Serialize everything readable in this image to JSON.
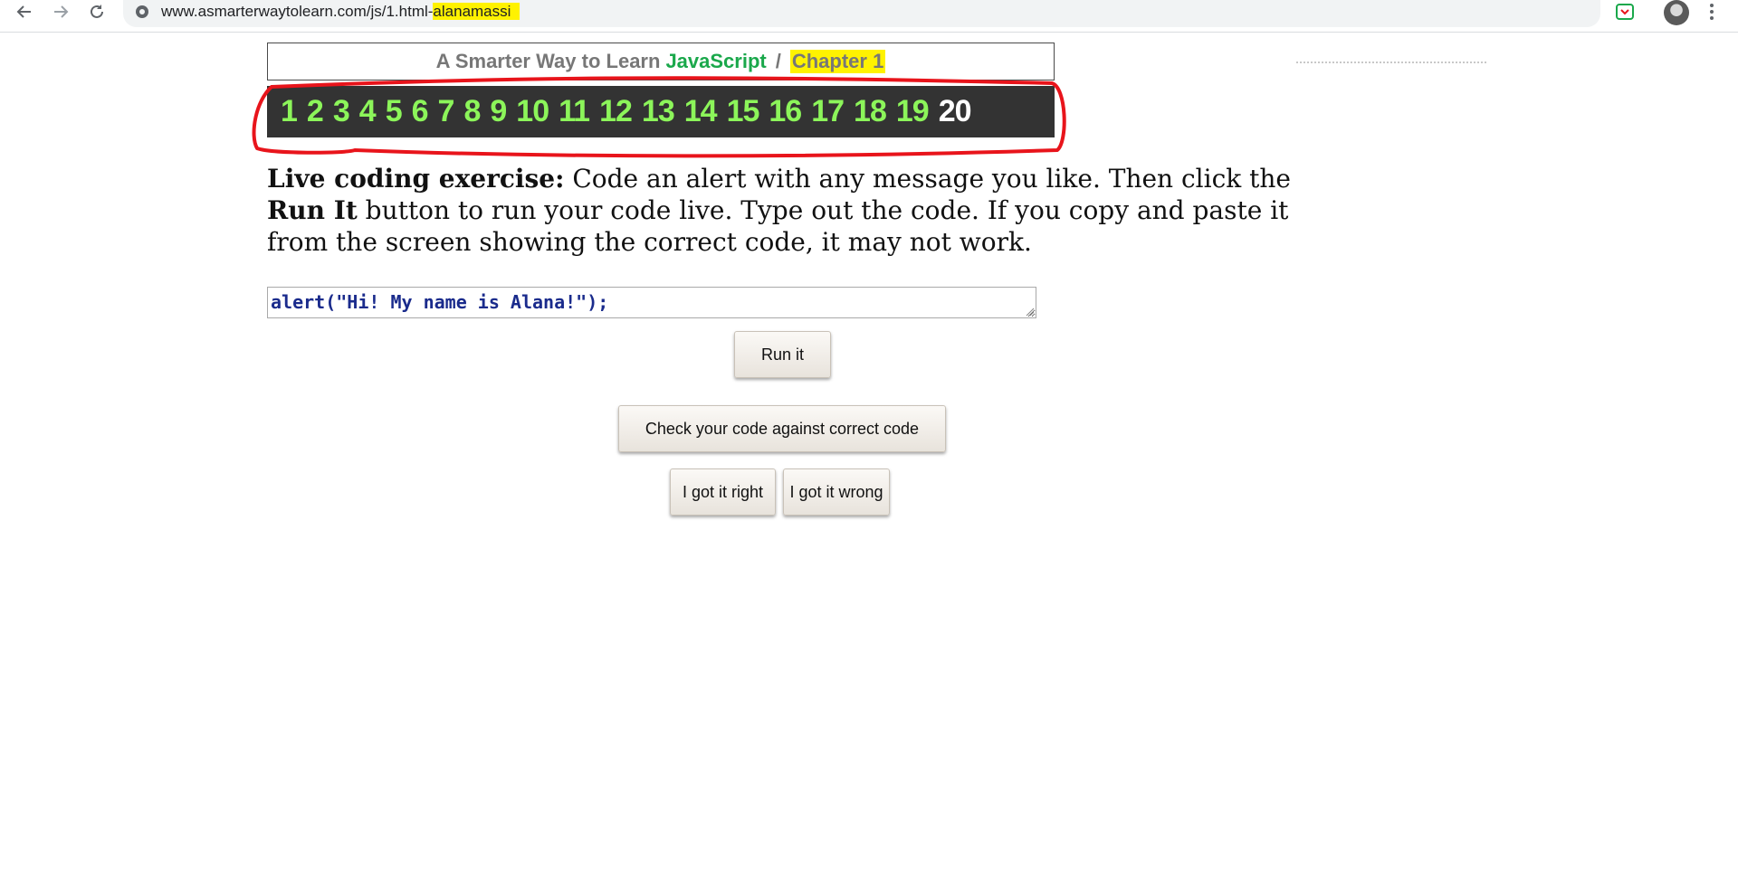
{
  "browser": {
    "url_base": "www.asmarterwaytolearn.com/js/1.html-",
    "url_highlight": "alanamassi",
    "icons": [
      "back-arrow-icon",
      "forward-arrow-icon",
      "reload-icon",
      "site-info-icon",
      "extension-icon",
      "profile-avatar",
      "menu-dots-icon"
    ]
  },
  "header": {
    "title_prefix": "A Smarter Way to Learn",
    "title_js": "JavaScript",
    "separator": "/",
    "chapter": "Chapter 1"
  },
  "chapters": [
    "1",
    "2",
    "3",
    "4",
    "5",
    "6",
    "7",
    "8",
    "9",
    "10",
    "11",
    "12",
    "13",
    "14",
    "15",
    "16",
    "17",
    "18",
    "19",
    "20"
  ],
  "current_chapter": "20",
  "exercise": {
    "lead": "Live coding exercise:",
    "text1": " Code an alert with any message you like. Then click the ",
    "run_bold": "Run It",
    "text2": " button to run your code live. Type out the code. If you copy and paste it from the screen showing the correct code, it may not work."
  },
  "code_value": "alert(\"Hi! My name is Alana!\");",
  "buttons": {
    "run": "Run it",
    "check": "Check your code against correct code",
    "right": "I got it right",
    "wrong": "I got it wrong"
  },
  "colors": {
    "number_green": "#8cf55a",
    "js_green": "#1aa84b",
    "highlight_yellow": "#fff200",
    "annotation_red": "#e8141b",
    "bar_dark": "#333333"
  }
}
